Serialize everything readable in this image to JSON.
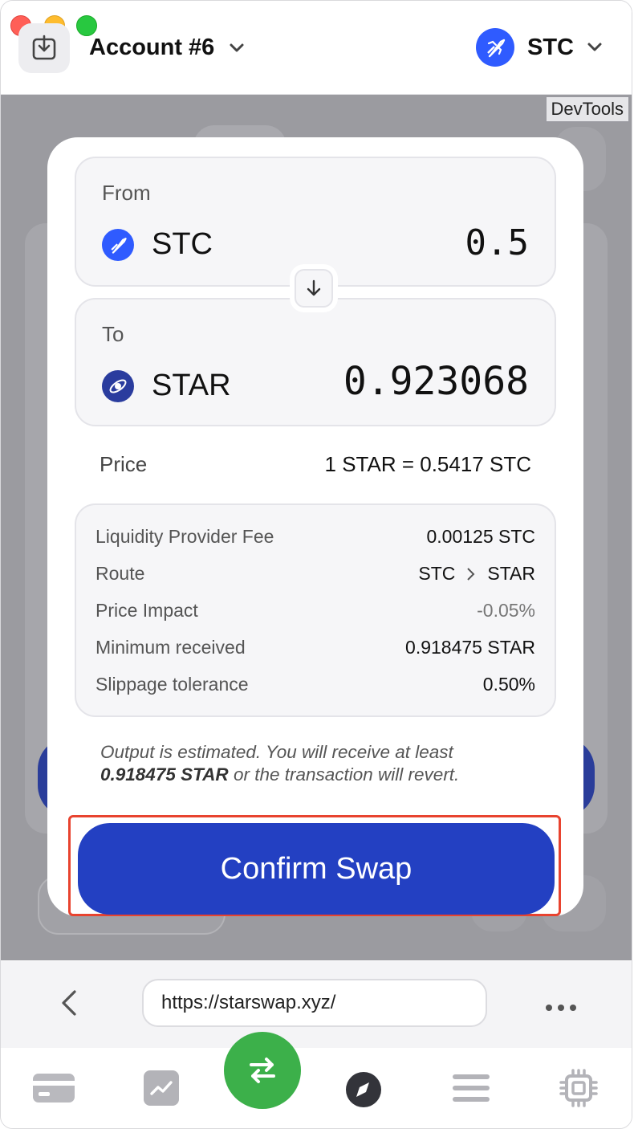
{
  "titlebar": {
    "account_label": "Account #6",
    "network_label": "STC",
    "devtools_label": "DevTools"
  },
  "swap": {
    "from": {
      "label": "From",
      "token": "STC",
      "amount": "0.5"
    },
    "to": {
      "label": "To",
      "token": "STAR",
      "amount": "0.923068"
    },
    "price": {
      "label": "Price",
      "value": "1 STAR = 0.5417 STC"
    },
    "details": [
      {
        "label": "Liquidity Provider Fee",
        "value": "0.00125 STC"
      },
      {
        "label": "Route",
        "value_from": "STC",
        "value_to": "STAR"
      },
      {
        "label": "Price Impact",
        "value": "-0.05%"
      },
      {
        "label": "Minimum received",
        "value": "0.918475 STAR"
      },
      {
        "label": "Slippage tolerance",
        "value": "0.50%"
      }
    ],
    "note_prefix": "Output is estimated. You will receive at least",
    "note_amount": "0.918475 STAR",
    "note_suffix": "or the transaction will revert.",
    "confirm_label": "Confirm Swap"
  },
  "browser": {
    "url": "https://starswap.xyz/"
  },
  "colors": {
    "primary": "#2340c2",
    "stc_blue": "#2f5bff",
    "swap_green": "#3cb04a",
    "highlight_red": "#e8432f"
  },
  "icons": [
    "import-icon",
    "chevron-down-icon",
    "starcoin-logo-icon",
    "star-token-icon",
    "arrow-down-icon",
    "back-icon",
    "more-icon",
    "wallet-icon",
    "chart-icon",
    "swap-icon",
    "compass-icon",
    "menu-icon",
    "chip-icon"
  ]
}
